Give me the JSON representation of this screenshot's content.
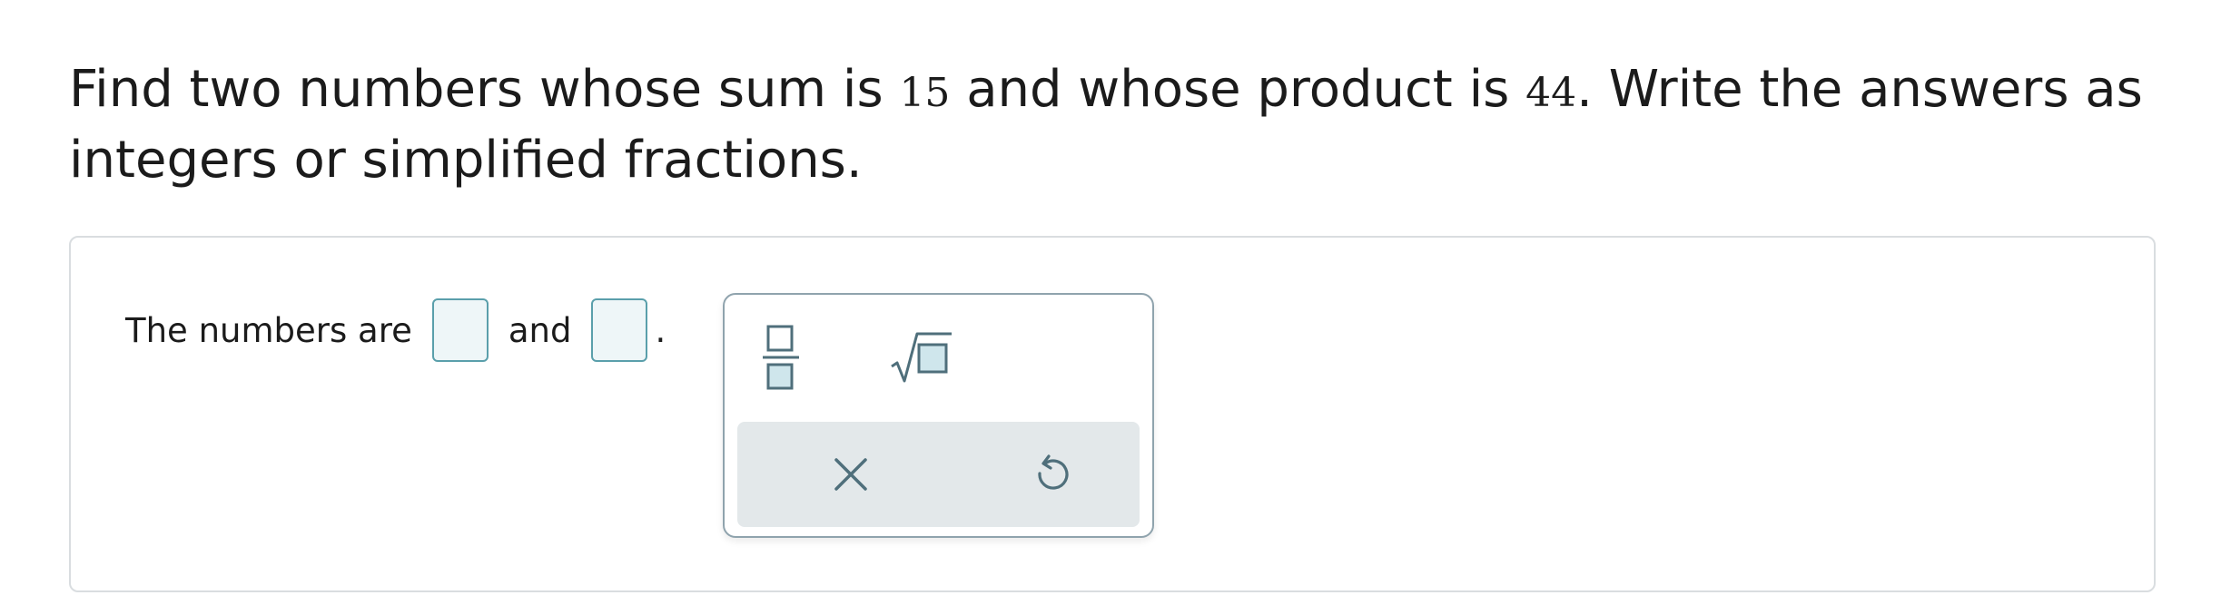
{
  "question": {
    "part1": "Find two numbers whose sum is ",
    "sum_value": "15",
    "part2": " and whose product is ",
    "product_value": "44",
    "part3": ". Write the answers as integers or simplified fractions."
  },
  "answer": {
    "prefix": "The numbers are",
    "conjunction": "and",
    "suffix": ".",
    "first_value": "",
    "second_value": ""
  },
  "palette": {
    "buttons": [
      {
        "name": "fraction-button",
        "icon": "fraction-icon"
      },
      {
        "name": "square-root-button",
        "icon": "square-root-icon"
      },
      {
        "name": "clear-button",
        "icon": "close-icon"
      },
      {
        "name": "undo-button",
        "icon": "undo-icon"
      }
    ],
    "icon_color": "#4f6f7b",
    "accent_color": "#5a9fab"
  }
}
